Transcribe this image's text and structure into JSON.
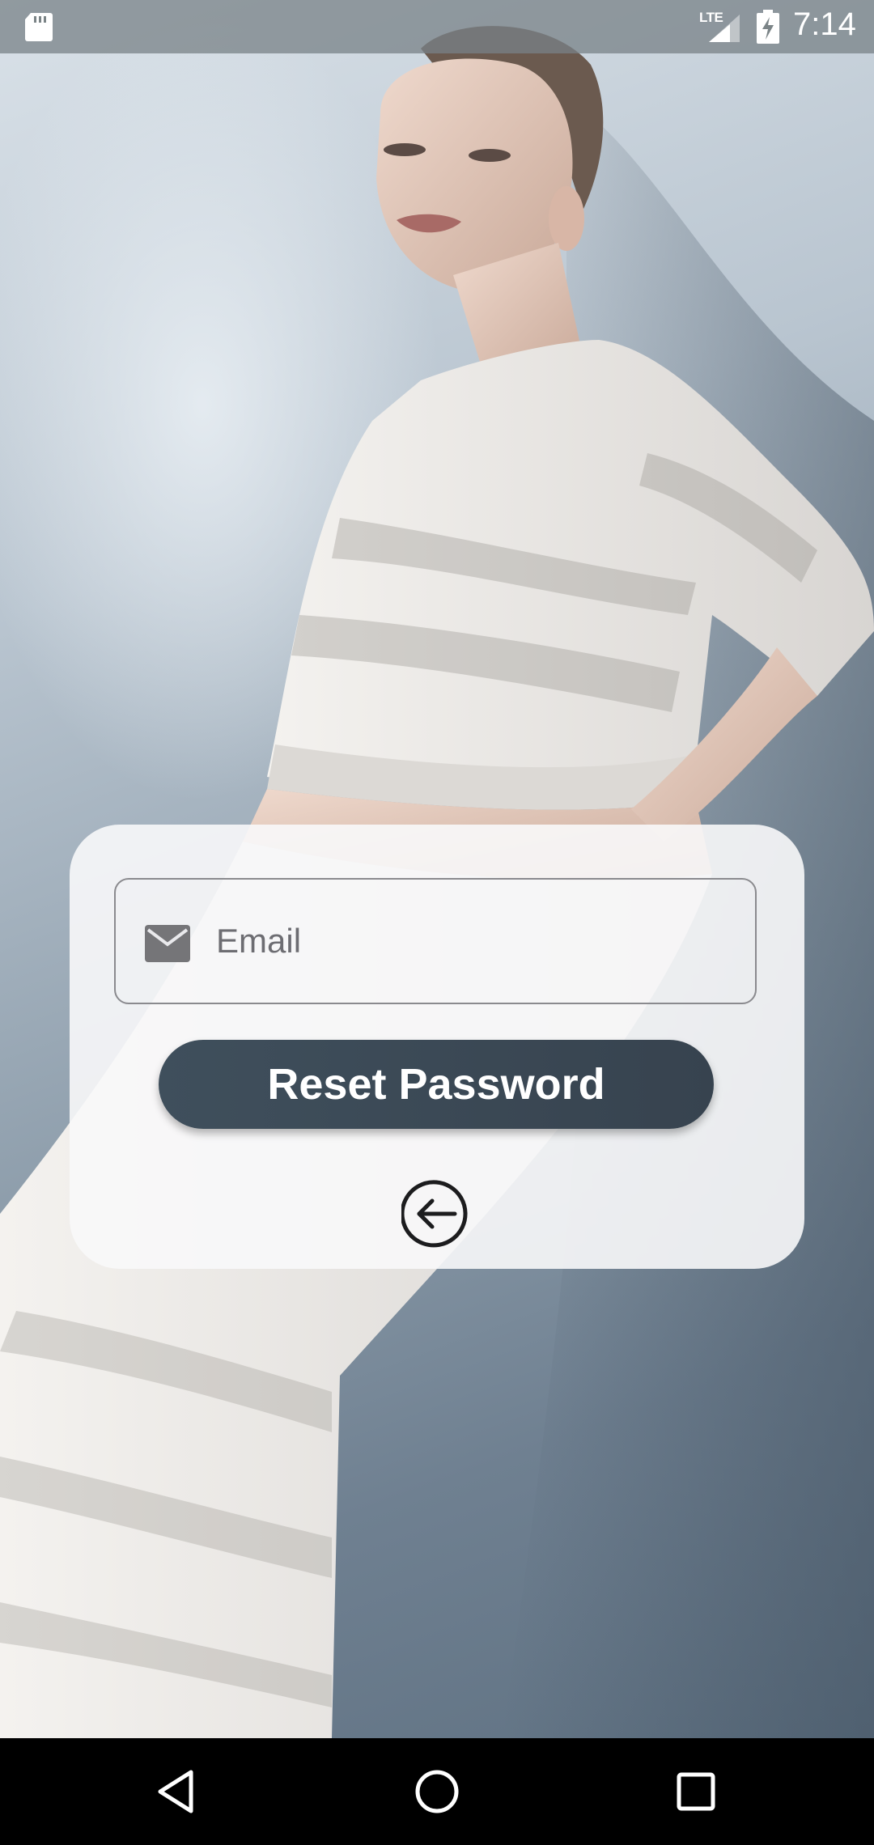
{
  "status_bar": {
    "network_label": "LTE",
    "time": "7:14",
    "icons": [
      "sd-card-icon",
      "signal-icon",
      "battery-charging-icon"
    ]
  },
  "background": {
    "description_icon": "photo-woman-white-knit-outfit"
  },
  "form": {
    "email_placeholder": "Email",
    "email_value": "",
    "email_icon": "mail-icon",
    "reset_button_label": "Reset Password",
    "back_icon": "back-arrow-circle-icon"
  },
  "nav_bar": {
    "icons": [
      "nav-back-icon",
      "nav-home-icon",
      "nav-recents-icon"
    ]
  },
  "colors": {
    "button": "#3d4b58",
    "card": "#f7f7f9",
    "field_border": "#8a8a8e",
    "status_bar": "#7b8487"
  }
}
